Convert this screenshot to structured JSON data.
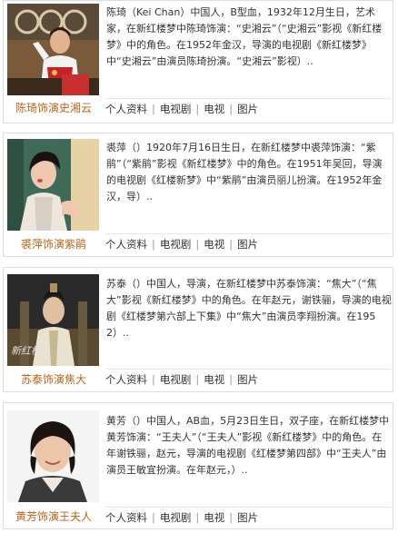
{
  "cards": [
    {
      "caption": "陈琦饰演史湘云",
      "bio": "陈琦（Kei Chan）中国人，B型血，1932年12月生日，艺术家，在新红楼梦中陈琦饰演：“史湘云”（“史湘云”影视《新红楼梦》中的角色。在1952年金汉，导演的电视剧《新红楼梦》中“史湘云”由演员陈琦扮演。“史湘云”影视）..",
      "links": [
        "个人资料",
        "电视剧",
        "电视",
        "图片"
      ]
    },
    {
      "caption": "裘萍饰演紫鹃",
      "bio": "裘萍（）1920年7月16日生日，在新红楼梦中裘萍饰演：“紫鹃”（“紫鹃”影视《新红楼梦》中的角色。在1951年吴回，导演的电视剧《红楼新梦》中“紫鹃”由演员丽儿扮演。在1952年金汉，导）..",
      "links": [
        "个人资料",
        "电视剧",
        "电视",
        "图片"
      ]
    },
    {
      "caption": "苏泰饰演焦大",
      "bio": "苏泰（）中国人，导演，在新红楼梦中苏泰饰演：“焦大”（“焦大”影视《新红楼梦》中的角色。在年赵元，谢铁骊，导演的电视剧《红楼梦第六部上下集》中“焦大”由演员李翔扮演。在1952）..",
      "links": [
        "个人资料",
        "电视剧",
        "电视",
        "图片"
      ]
    },
    {
      "caption": "黄芳饰演王夫人",
      "bio": "黄芳（）中国人，AB血，5月23日生日，双子座，在新红楼梦中黄芳饰演：“王夫人”（“王夫人”影视《新红楼梦》中的角色。在年谢铁骊，赵元，导演的电视剧《红楼梦第四部》中“王夫人”由演员王敏宜扮演。在年赵元，）..",
      "links": [
        "个人资料",
        "电视剧",
        "电视",
        "图片"
      ]
    }
  ]
}
